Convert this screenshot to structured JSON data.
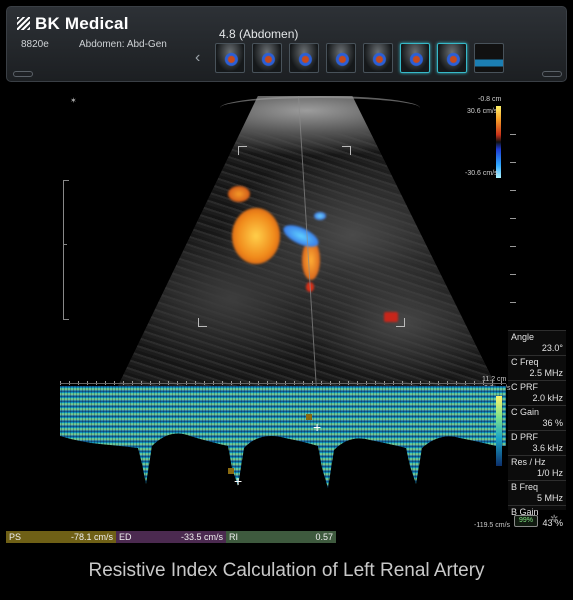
{
  "header": {
    "brand": "BK Medical",
    "device": "8820e",
    "preset": "Abdomen: Abd-Gen",
    "study": "4.8  (Abdomen)",
    "thumbnail_count": 8,
    "selected_thumbnails": [
      5,
      6
    ]
  },
  "color_scale": {
    "top_label": "-0.8 cm",
    "max": "30.6 cm/s",
    "min": "-30.6 cm/s"
  },
  "spectral_scale": {
    "top": "11.2 cm",
    "zero": "0.0 cm/s",
    "bottom": "-119.5 cm/s"
  },
  "params": [
    {
      "label": "Angle",
      "value": "23.0°"
    },
    {
      "label": "C Freq",
      "value": "2.5 MHz"
    },
    {
      "label": "C PRF",
      "value": "2.0 kHz"
    },
    {
      "label": "C Gain",
      "value": "36 %"
    },
    {
      "label": "D PRF",
      "value": "3.6 kHz"
    },
    {
      "label": "Res / Hz",
      "value": "1/0 Hz"
    },
    {
      "label": "B Freq",
      "value": "5 MHz"
    },
    {
      "label": "B Gain",
      "value": "43 %"
    }
  ],
  "battery": "99%",
  "measurements": [
    {
      "label": "PS",
      "value": "-78.1 cm/s"
    },
    {
      "label": "ED",
      "value": "-33.5 cm/s"
    },
    {
      "label": "RI",
      "value": "0.57"
    }
  ],
  "caption": "Resistive Index Calculation of Left Renal Artery",
  "colors": {
    "ps": "#6f6016",
    "ed": "#4b2a50",
    "ri": "#3e5a3e",
    "selected_thumb": "#37b9c8"
  }
}
